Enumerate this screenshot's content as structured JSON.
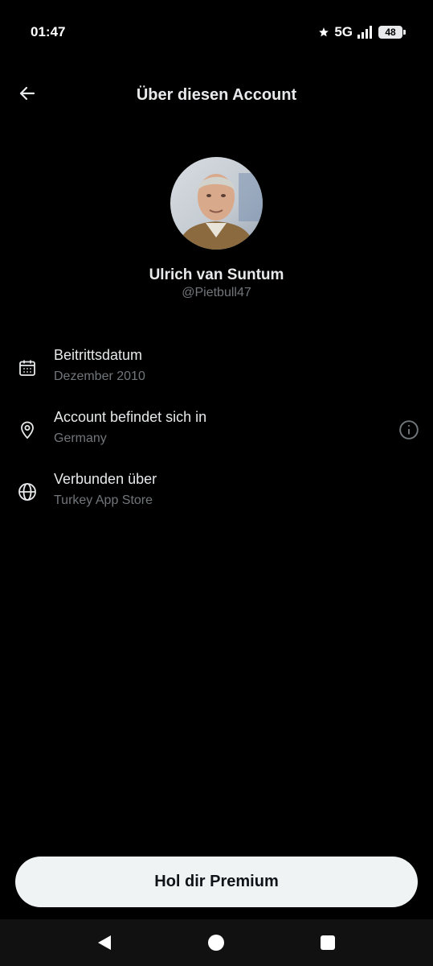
{
  "status_bar": {
    "time": "01:47",
    "network": "5G",
    "battery": "48",
    "icons": [
      "star-icon",
      "signal-icon",
      "battery-icon"
    ]
  },
  "header": {
    "title": "Über diesen Account",
    "back_icon": "back-arrow-icon"
  },
  "profile": {
    "name": "Ulrich van Suntum",
    "handle": "@Pietbull47"
  },
  "info": [
    {
      "icon": "calendar-icon",
      "title": "Beitrittsdatum",
      "value": "Dezember 2010"
    },
    {
      "icon": "location-pin-icon",
      "title": "Account befindet sich in",
      "value": "Germany",
      "action_icon": "info-icon"
    },
    {
      "icon": "globe-icon",
      "title": "Verbunden über",
      "value": "Turkey App Store"
    }
  ],
  "premium_button": {
    "label": "Hol dir Premium"
  },
  "navigation": {
    "icons": [
      "nav-back-icon",
      "nav-home-icon",
      "nav-recents-icon"
    ]
  },
  "colors": {
    "background": "#000000",
    "primary_text": "#e7e9ea",
    "secondary_text": "#71767b",
    "button_background": "#eff3f4",
    "button_text": "#0f1419"
  }
}
